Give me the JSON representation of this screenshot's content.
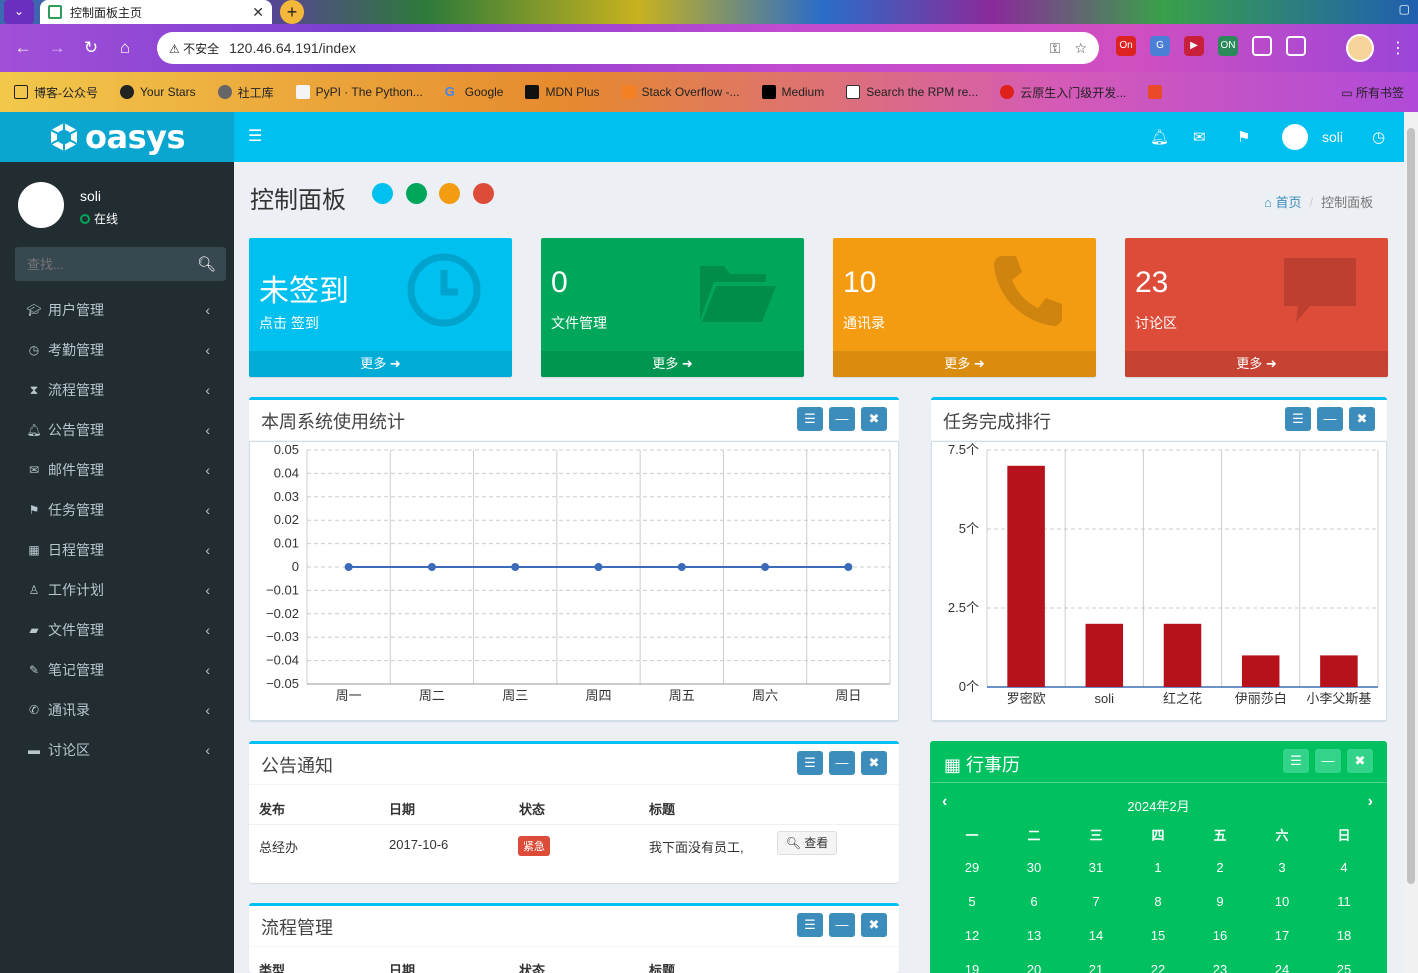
{
  "browser": {
    "tab_title": "控制面板主页",
    "insecure_label": "不安全",
    "url": "120.46.64.191/index",
    "bookmarks": [
      "博客-公众号",
      "Your Stars",
      "社工库",
      "PyPI · The Python...",
      "Google",
      "MDN Plus",
      "Stack Overflow -...",
      "Medium",
      "Search the RPM re...",
      "云原生入门级开发..."
    ],
    "all_bookmarks": "所有书签",
    "colors": {
      "tab_menu": "#6a2fbf",
      "new_tab": "#f4b73a"
    }
  },
  "app": {
    "logo_text": "oasys",
    "header_user": "soli",
    "header_icons": [
      "bell-icon",
      "envelope-icon",
      "flag-icon",
      "clock-icon"
    ]
  },
  "sidebar": {
    "username": "soli",
    "status": "在线",
    "search_placeholder": "查找...",
    "items": [
      {
        "label": "用户管理",
        "icon": "graduation-cap-icon"
      },
      {
        "label": "考勤管理",
        "icon": "clock-icon"
      },
      {
        "label": "流程管理",
        "icon": "hourglass-icon"
      },
      {
        "label": "公告管理",
        "icon": "bell-icon"
      },
      {
        "label": "邮件管理",
        "icon": "envelope-icon"
      },
      {
        "label": "任务管理",
        "icon": "flag-icon"
      },
      {
        "label": "日程管理",
        "icon": "calendar-icon"
      },
      {
        "label": "工作计划",
        "icon": "user-icon"
      },
      {
        "label": "文件管理",
        "icon": "folder-icon"
      },
      {
        "label": "笔记管理",
        "icon": "edit-icon"
      },
      {
        "label": "通讯录",
        "icon": "phone-icon"
      },
      {
        "label": "讨论区",
        "icon": "comment-icon"
      }
    ]
  },
  "page": {
    "title": "控制面板",
    "swatches": [
      "#00c0ef",
      "#00a65a",
      "#f39c12",
      "#dd4b39"
    ],
    "breadcrumb": {
      "home": "首页",
      "current": "控制面板"
    }
  },
  "stat_boxes": [
    {
      "big": "未签到",
      "sub": "点击 签到",
      "more": "更多",
      "color": "#00c0ef",
      "icon": "clock-icon"
    },
    {
      "big": "0",
      "sub": "文件管理",
      "more": "更多",
      "color": "#00a65a",
      "icon": "folder-open-icon"
    },
    {
      "big": "10",
      "sub": "通讯录",
      "more": "更多",
      "color": "#f39c12",
      "icon": "phone-icon"
    },
    {
      "big": "23",
      "sub": "讨论区",
      "more": "更多",
      "color": "#dd4b39",
      "icon": "comment-icon"
    }
  ],
  "usage_box": {
    "title": "本周系统使用统计"
  },
  "rank_box": {
    "title": "任务完成排行"
  },
  "notice_box": {
    "title": "公告通知",
    "headers": [
      "发布",
      "日期",
      "状态",
      "标题"
    ],
    "rows": [
      {
        "publisher": "总经办",
        "date": "2017-10-6",
        "status": "紧急",
        "title": "我下面没有员工,",
        "action": "查看"
      }
    ]
  },
  "process_box": {
    "title": "流程管理",
    "headers": [
      "类型",
      "日期",
      "状态",
      "标题"
    ]
  },
  "calendar": {
    "title": "行事历",
    "month": "2024年2月",
    "weekdays": [
      "一",
      "二",
      "三",
      "四",
      "五",
      "六",
      "日"
    ],
    "weeks": [
      [
        "29",
        "30",
        "31",
        "1",
        "2",
        "3",
        "4"
      ],
      [
        "5",
        "6",
        "7",
        "8",
        "9",
        "10",
        "11"
      ],
      [
        "12",
        "13",
        "14",
        "15",
        "16",
        "17",
        "18"
      ],
      [
        "19",
        "20",
        "21",
        "22",
        "23",
        "24",
        "25"
      ]
    ]
  },
  "chart_data": [
    {
      "type": "line",
      "categories": [
        "周一",
        "周二",
        "周三",
        "周四",
        "周五",
        "周六",
        "周日"
      ],
      "series": [
        {
          "values": [
            0,
            0,
            0,
            0,
            0,
            0,
            0
          ]
        }
      ],
      "yticks": [
        "0.05",
        "0.04",
        "0.03",
        "0.02",
        "0.01",
        "0",
        "−0.01",
        "−0.02",
        "−0.03",
        "−0.04",
        "−0.05"
      ],
      "ylim": [
        -0.05,
        0.05
      ],
      "grid": true,
      "color": "#3b6bb8"
    },
    {
      "type": "bar",
      "categories": [
        "罗密欧",
        "soli",
        "红之花",
        "伊丽莎白",
        "小李父斯基"
      ],
      "values": [
        7,
        2,
        2,
        1,
        1
      ],
      "yticks": [
        "7.5个",
        "5个",
        "2.5个",
        "0个"
      ],
      "ylim": [
        0,
        7.5
      ],
      "grid": true,
      "color": "#b5121b"
    }
  ]
}
